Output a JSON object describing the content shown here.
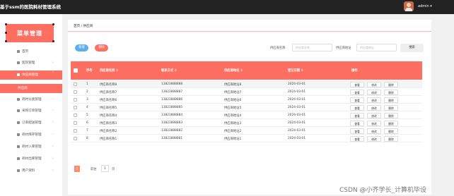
{
  "app": {
    "title": "基于ssm的医院耗材管理系统",
    "user": "admin ▾"
  },
  "sidebar": {
    "logo": "菜单管理",
    "items": [
      {
        "label": "首页",
        "arrow": ""
      },
      {
        "label": "医院管理",
        "arrow": "⌵"
      },
      {
        "label": "供应商管理",
        "arrow": "⌃"
      },
      {
        "label": "供应商",
        "arrow": ""
      },
      {
        "label": "耗材分类管理",
        "arrow": "⌵"
      },
      {
        "label": "采购订单管理",
        "arrow": "⌵"
      },
      {
        "label": "订单配送管理",
        "arrow": "⌵"
      },
      {
        "label": "耗材库存管理",
        "arrow": "⌵"
      },
      {
        "label": "耗材入库管理",
        "arrow": "⌵"
      },
      {
        "label": "耗材出库管理",
        "arrow": "⌵"
      },
      {
        "label": "用户资料",
        "arrow": "⌵"
      }
    ]
  },
  "breadcrumb": "首页 / 供应商",
  "toolbar": {
    "add_label": "新增",
    "delete_label": "删除",
    "name_label": "供应商名称",
    "name_placeholder": "供应商名称",
    "address_label": "供应商地址",
    "address_placeholder": "供应商地址",
    "search_label": "搜索"
  },
  "table": {
    "headers": [
      "序号",
      "供应商名称 ⇕",
      "联系方式 ⇕",
      "供应商地址 ⇕",
      "登记日期 ⇕",
      "操作"
    ],
    "actions": [
      "查看",
      "修改",
      "删除"
    ],
    "rows": [
      {
        "no": "1",
        "name": "供应商名称8",
        "phone": "13823888888",
        "addr": "供应商地址8",
        "date": "2024-03-01"
      },
      {
        "no": "2",
        "name": "供应商名称7",
        "phone": "13823888887",
        "addr": "供应商地址7",
        "date": "2024-03-01"
      },
      {
        "no": "3",
        "name": "供应商名称6",
        "phone": "13823888886",
        "addr": "供应商地址6",
        "date": "2024-03-01"
      },
      {
        "no": "4",
        "name": "供应商名称5",
        "phone": "13823888885",
        "addr": "供应商地址5",
        "date": "2024-03-01"
      },
      {
        "no": "5",
        "name": "供应商名称4",
        "phone": "13823888884",
        "addr": "供应商地址4",
        "date": "2024-03-01"
      },
      {
        "no": "6",
        "name": "供应商名称3",
        "phone": "13823888883",
        "addr": "供应商地址3",
        "date": "2024-03-01"
      },
      {
        "no": "7",
        "name": "供应商名称2",
        "phone": "13823888882",
        "addr": "供应商地址2",
        "date": "2024-03-01"
      },
      {
        "no": "8",
        "name": "供应商名称1",
        "phone": "13823888881",
        "addr": "供应商地址1",
        "date": "2024-03-01"
      }
    ]
  },
  "pager": {
    "current": "1",
    "goto_label": "前往",
    "page_value": "1",
    "page_unit": "页"
  },
  "watermark": "CSDN @小齐学长_计算机毕设",
  "colors": {
    "accent": "#ff6f61",
    "primary": "#5ab0ef",
    "topbar": "#222222"
  },
  "icons": {
    "avatar": "user-avatar-icon"
  }
}
